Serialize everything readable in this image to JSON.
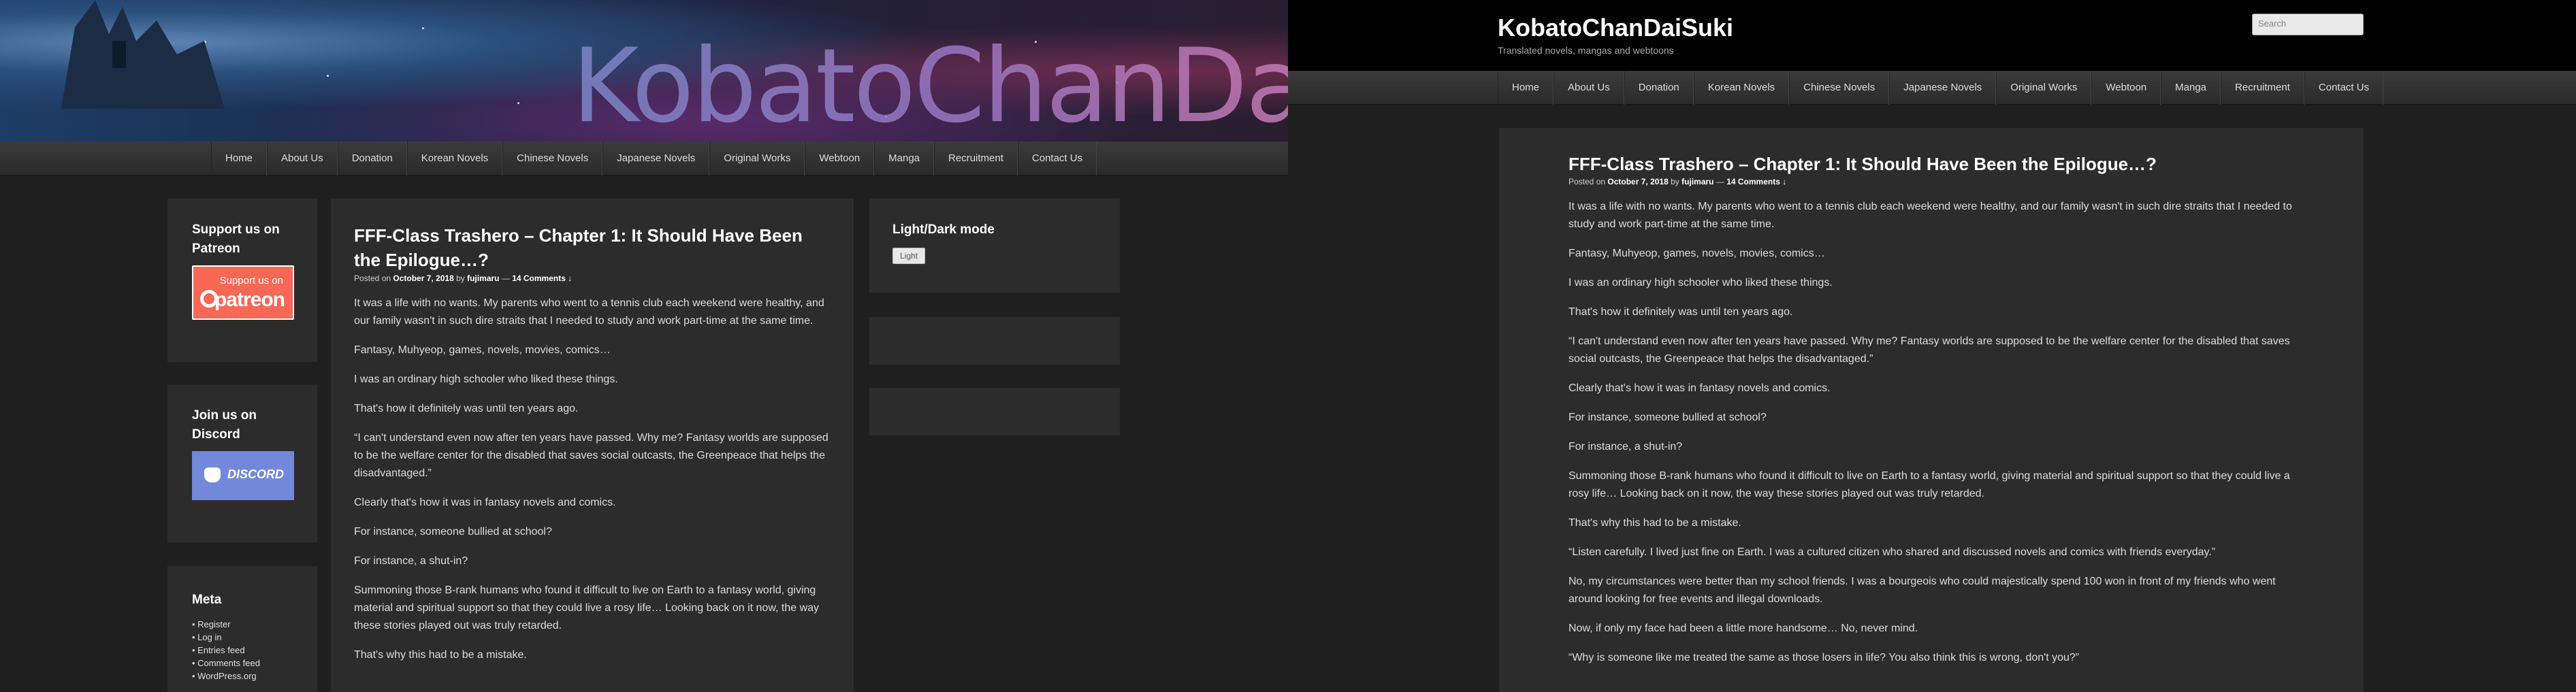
{
  "site": {
    "title": "KobatoChanDaiSuki",
    "description": "Translated novels, mangas and webtoons",
    "search_placeholder": "Search"
  },
  "nav": [
    "Home",
    "About Us",
    "Donation",
    "Korean Novels",
    "Chinese Novels",
    "Japanese Novels",
    "Original Works",
    "Webtoon",
    "Manga",
    "Recruitment",
    "Contact Us"
  ],
  "sidebar": {
    "patreon_title": "Support us on Patreon",
    "patreon_logo_small": "Support us on",
    "patreon_logo_big": "patreon",
    "discord_title": "Join us on Discord",
    "discord_logo_text": "DISCORD",
    "meta_title": "Meta",
    "meta_links": [
      "Register",
      "Log in",
      "Entries feed",
      "Comments feed",
      "WordPress.org"
    ],
    "mode_title": "Light/Dark mode",
    "mode_button": "Light"
  },
  "post": {
    "title": "FFF-Class Trashero – Chapter 1: It Should Have Been the Epilogue…?",
    "posted_on": "Posted on",
    "date": "October 7, 2018",
    "by": "by",
    "author": "fujimaru",
    "dash": "—",
    "comments": "14 Comments ↓",
    "paragraphs": [
      "It was a life with no wants. My parents who went to a tennis club each weekend were healthy, and our family wasn't in such dire straits that I needed to study and work part-time at the same time.",
      "Fantasy, Muhyeop, games, novels, movies, comics…",
      "I was an ordinary high schooler who liked these things.",
      "That's how it definitely was until ten years ago.",
      "“I can't understand even now after ten years have passed. Why me? Fantasy worlds are supposed to be the welfare center for the disabled that saves social outcasts, the Greenpeace that helps the disadvantaged.”",
      "Clearly that's how it was in fantasy novels and comics.",
      "For instance, someone bullied at school?",
      "For instance, a shut-in?",
      "Summoning those B-rank humans who found it difficult to live on Earth to a fantasy world, giving material and spiritual support so that they could live a rosy life… Looking back on it now, the way these stories played out was truly retarded.",
      "That's why this had to be a mistake.",
      "“Listen carefully. I lived just fine on Earth. I was a cultured citizen who shared and discussed novels and comics with friends everyday.”",
      "No, my circumstances were better than my school friends. I was a bourgeois who could majestically spend 100 won in front of my friends who went around looking for free events and illegal downloads.",
      "Now, if only my face had been a little more handsome… No, never mind.",
      "“Why is someone like me treated the same as those losers in life? You also think this is wrong, don't you?”"
    ]
  },
  "colors": {
    "background": "#1f1f1f",
    "panel": "#2c2c2c",
    "patreon": "#f96854",
    "discord": "#7289da"
  }
}
